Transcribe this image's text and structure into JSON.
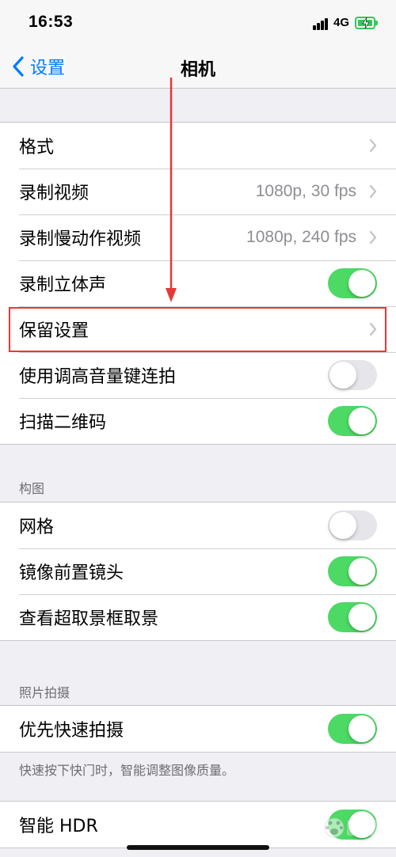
{
  "status_bar": {
    "time": "16:53",
    "network": "4G",
    "battery_color": "#34c759"
  },
  "nav": {
    "back_label": "设置",
    "title": "相机",
    "accent_color": "#007aff"
  },
  "settings_group_1": [
    {
      "label": "格式",
      "type": "link"
    },
    {
      "label": "录制视频",
      "type": "link",
      "value": "1080p, 30 fps"
    },
    {
      "label": "录制慢动作视频",
      "type": "link",
      "value": "1080p, 240 fps"
    },
    {
      "label": "录制立体声",
      "type": "toggle",
      "on": true
    },
    {
      "label": "保留设置",
      "type": "link",
      "highlighted": true
    },
    {
      "label": "使用调高音量键连拍",
      "type": "toggle",
      "on": false
    },
    {
      "label": "扫描二维码",
      "type": "toggle",
      "on": true
    }
  ],
  "composition": {
    "header": "构图",
    "items": [
      {
        "label": "网格",
        "type": "toggle",
        "on": false
      },
      {
        "label": "镜像前置镜头",
        "type": "toggle",
        "on": true
      },
      {
        "label": "查看超取景框取景",
        "type": "toggle",
        "on": true
      }
    ]
  },
  "photo_capture": {
    "header": "照片拍摄",
    "items": [
      {
        "label": "优先快速拍摄",
        "type": "toggle",
        "on": true
      }
    ],
    "footer": "快速按下快门时，智能调整图像质量。"
  },
  "smart_hdr": {
    "items": [
      {
        "label": "智能 HDR",
        "type": "toggle",
        "on": true
      }
    ]
  },
  "annotation": {
    "highlight_color": "#e53935"
  },
  "toggle_on_color": "#4cd964"
}
